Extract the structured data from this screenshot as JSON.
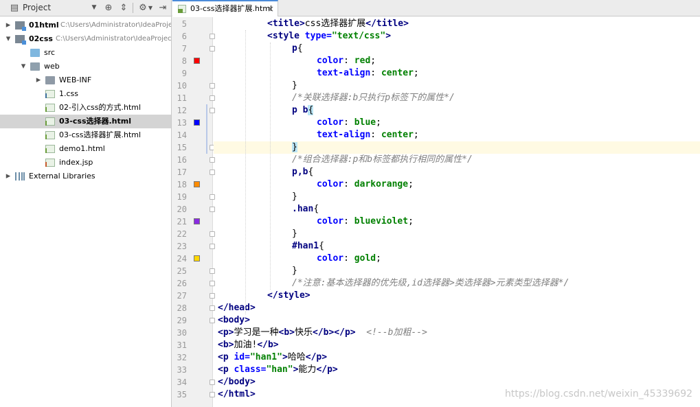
{
  "project_panel": {
    "title": "Project",
    "header_icons": [
      "dropdown-icon",
      "target-icon",
      "collapse-icon",
      "gear-icon",
      "hide-icon"
    ],
    "tree": [
      {
        "label": "01html",
        "path": "C:\\Users\\Administrator\\IdeaProjec",
        "bold": true,
        "depth": 0,
        "arrow": "right",
        "icon": "module"
      },
      {
        "label": "02css",
        "path": "C:\\Users\\Administrator\\IdeaProject",
        "bold": true,
        "depth": 0,
        "arrow": "down",
        "icon": "module"
      },
      {
        "label": "src",
        "depth": 1,
        "arrow": "",
        "icon": "src-folder"
      },
      {
        "label": "web",
        "depth": 1,
        "arrow": "down",
        "icon": "web-folder"
      },
      {
        "label": "WEB-INF",
        "depth": 2,
        "arrow": "right",
        "icon": "folder"
      },
      {
        "label": "1.css",
        "depth": 2,
        "arrow": "",
        "icon": "css"
      },
      {
        "label": "02-引入css的方式.html",
        "depth": 2,
        "arrow": "",
        "icon": "html"
      },
      {
        "label": "03-css选择器.html",
        "depth": 2,
        "arrow": "",
        "icon": "html",
        "selected": true
      },
      {
        "label": "03-css选择器扩展.html",
        "depth": 2,
        "arrow": "",
        "icon": "html"
      },
      {
        "label": "demo1.html",
        "depth": 2,
        "arrow": "",
        "icon": "html"
      },
      {
        "label": "index.jsp",
        "depth": 2,
        "arrow": "",
        "icon": "jsp"
      },
      {
        "label": "External Libraries",
        "depth": 0,
        "arrow": "right",
        "icon": "library"
      }
    ]
  },
  "editor": {
    "tab_label": "03-css选择器扩展.html",
    "caret_line": 15,
    "lines": [
      {
        "n": "5",
        "indent": 2,
        "tokens": [
          [
            "tg",
            "<title>"
          ],
          [
            "tx",
            "css选择器扩展"
          ],
          [
            "tg",
            "</title>"
          ]
        ]
      },
      {
        "n": "6",
        "indent": 2,
        "fold": true,
        "tokens": [
          [
            "tg",
            "<style "
          ],
          [
            "at",
            "type="
          ],
          [
            "av",
            "\"text/css\""
          ],
          [
            "tg",
            ">"
          ]
        ]
      },
      {
        "n": "7",
        "indent": 3,
        "fold": true,
        "tokens": [
          [
            "sel",
            "p"
          ],
          [
            "br",
            "{"
          ]
        ]
      },
      {
        "n": "8",
        "indent": 4,
        "swatch": "#ff0000",
        "tokens": [
          [
            "pn",
            "color"
          ],
          [
            "br",
            ": "
          ],
          [
            "pv",
            "red"
          ],
          [
            "br",
            ";"
          ]
        ]
      },
      {
        "n": "9",
        "indent": 4,
        "tokens": [
          [
            "pn",
            "text-align"
          ],
          [
            "br",
            ": "
          ],
          [
            "pv",
            "center"
          ],
          [
            "br",
            ";"
          ]
        ]
      },
      {
        "n": "10",
        "indent": 3,
        "fold": true,
        "tokens": [
          [
            "br",
            "}"
          ]
        ]
      },
      {
        "n": "11",
        "indent": 3,
        "fold": true,
        "tokens": [
          [
            "cm",
            "/*关联选择器:b只执行p标签下的属性*/"
          ]
        ]
      },
      {
        "n": "12",
        "indent": 3,
        "fold": true,
        "change": true,
        "tokens": [
          [
            "sel",
            "p b"
          ],
          [
            "hl",
            "{"
          ]
        ]
      },
      {
        "n": "13",
        "indent": 4,
        "swatch": "#0000ff",
        "change": true,
        "tokens": [
          [
            "pn",
            "color"
          ],
          [
            "br",
            ": "
          ],
          [
            "pv",
            "blue"
          ],
          [
            "br",
            ";"
          ]
        ]
      },
      {
        "n": "14",
        "indent": 4,
        "change": true,
        "tokens": [
          [
            "pn",
            "text-align"
          ],
          [
            "br",
            ": "
          ],
          [
            "pv",
            "center"
          ],
          [
            "br",
            ";"
          ]
        ]
      },
      {
        "n": "15",
        "indent": 3,
        "fold": true,
        "change": true,
        "tokens": [
          [
            "hl",
            "}"
          ]
        ]
      },
      {
        "n": "16",
        "indent": 3,
        "fold": true,
        "tokens": [
          [
            "cm",
            "/*组合选择器:p和b标签都执行相同的属性*/"
          ]
        ]
      },
      {
        "n": "17",
        "indent": 3,
        "fold": true,
        "tokens": [
          [
            "sel",
            "p,b"
          ],
          [
            "br",
            "{"
          ]
        ]
      },
      {
        "n": "18",
        "indent": 4,
        "swatch": "#ff8c00",
        "tokens": [
          [
            "pn",
            "color"
          ],
          [
            "br",
            ": "
          ],
          [
            "pv",
            "darkorange"
          ],
          [
            "br",
            ";"
          ]
        ]
      },
      {
        "n": "19",
        "indent": 3,
        "fold": true,
        "tokens": [
          [
            "br",
            "}"
          ]
        ]
      },
      {
        "n": "20",
        "indent": 3,
        "fold": true,
        "tokens": [
          [
            "sel",
            ".han"
          ],
          [
            "br",
            "{"
          ]
        ]
      },
      {
        "n": "21",
        "indent": 4,
        "swatch": "#8a2be2",
        "tokens": [
          [
            "pn",
            "color"
          ],
          [
            "br",
            ": "
          ],
          [
            "pv",
            "blueviolet"
          ],
          [
            "br",
            ";"
          ]
        ]
      },
      {
        "n": "22",
        "indent": 3,
        "fold": true,
        "tokens": [
          [
            "br",
            "}"
          ]
        ]
      },
      {
        "n": "23",
        "indent": 3,
        "fold": true,
        "tokens": [
          [
            "sel",
            "#han1"
          ],
          [
            "br",
            "{"
          ]
        ]
      },
      {
        "n": "24",
        "indent": 4,
        "swatch": "#ffd700",
        "tokens": [
          [
            "pn",
            "color"
          ],
          [
            "br",
            ": "
          ],
          [
            "pv",
            "gold"
          ],
          [
            "br",
            ";"
          ]
        ]
      },
      {
        "n": "25",
        "indent": 3,
        "fold": true,
        "tokens": [
          [
            "br",
            "}"
          ]
        ]
      },
      {
        "n": "26",
        "indent": 3,
        "fold": true,
        "tokens": [
          [
            "cm",
            "/*注意:基本选择器的优先级,id选择器>类选择器>元素类型选择器*/"
          ]
        ]
      },
      {
        "n": "27",
        "indent": 2,
        "fold": true,
        "tokens": [
          [
            "tg",
            "</style>"
          ]
        ]
      },
      {
        "n": "28",
        "indent": 0,
        "fold": true,
        "tokens": [
          [
            "tg",
            "</head>"
          ]
        ]
      },
      {
        "n": "29",
        "indent": 0,
        "fold": true,
        "tokens": [
          [
            "tg",
            "<body>"
          ]
        ]
      },
      {
        "n": "30",
        "indent": 0,
        "tokens": [
          [
            "tg",
            "<p>"
          ],
          [
            "tx",
            "学习是一种"
          ],
          [
            "tg",
            "<b>"
          ],
          [
            "tx",
            "快乐"
          ],
          [
            "tg",
            "</b></p>"
          ],
          [
            "tx",
            "  "
          ],
          [
            "cm",
            "<!--b加粗-->"
          ]
        ]
      },
      {
        "n": "31",
        "indent": 0,
        "tokens": [
          [
            "tg",
            "<b>"
          ],
          [
            "tx",
            "加油!"
          ],
          [
            "tg",
            "</b>"
          ]
        ]
      },
      {
        "n": "32",
        "indent": 0,
        "tokens": [
          [
            "tg",
            "<p "
          ],
          [
            "at",
            "id="
          ],
          [
            "av",
            "\"han1\""
          ],
          [
            "tg",
            ">"
          ],
          [
            "tx",
            "哈哈"
          ],
          [
            "tg",
            "</p>"
          ]
        ]
      },
      {
        "n": "33",
        "indent": 0,
        "tokens": [
          [
            "tg",
            "<p "
          ],
          [
            "at",
            "class="
          ],
          [
            "av",
            "\"han\""
          ],
          [
            "tg",
            ">"
          ],
          [
            "tx",
            "能力"
          ],
          [
            "tg",
            "</p>"
          ]
        ]
      },
      {
        "n": "34",
        "indent": 0,
        "fold": true,
        "tokens": [
          [
            "tg",
            "</body>"
          ]
        ]
      },
      {
        "n": "35",
        "indent": 0,
        "fold": true,
        "tokens": [
          [
            "tg",
            "</html>"
          ]
        ]
      }
    ]
  },
  "watermark": "https://blog.csdn.net/weixin_45339692"
}
